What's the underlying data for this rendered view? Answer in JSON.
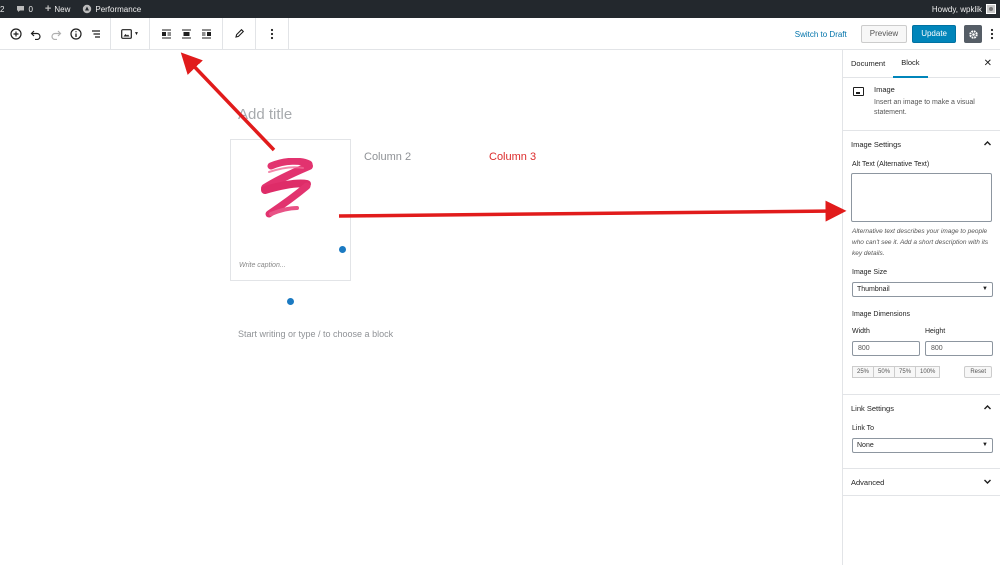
{
  "adminbar": {
    "site_fragment": "2",
    "comments_count": "0",
    "new_label": "New",
    "performance_label": "Performance",
    "howdy": "Howdy, wpklik"
  },
  "toolbar": {
    "switch_to_draft": "Switch to Draft",
    "preview": "Preview",
    "update": "Update"
  },
  "canvas": {
    "title_placeholder": "Add title",
    "caption_placeholder": "Write caption...",
    "column2": "Column 2",
    "column3": "Column 3",
    "block_placeholder": "Start writing or type / to choose a block",
    "colors": {
      "column3": "#dc2b2b",
      "handle": "#1b7ac2",
      "brush": "#e2336f",
      "arrow": "#e11b1b"
    }
  },
  "sidebar": {
    "tabs": [
      {
        "label": "Document"
      },
      {
        "label": "Block"
      }
    ],
    "block": {
      "name": "Image",
      "description": "Insert an image to make a visual statement."
    },
    "image_settings": {
      "title": "Image Settings",
      "alt_label": "Alt Text (Alternative Text)",
      "alt_help": "Alternative text describes your image to people who can't see it. Add a short description with its key details.",
      "size_label": "Image Size",
      "size_value": "Thumbnail",
      "dimensions_label": "Image Dimensions",
      "width_label": "Width",
      "height_label": "Height",
      "width_value": "800",
      "height_value": "800",
      "percent_buttons": [
        "25%",
        "50%",
        "75%",
        "100%"
      ],
      "reset": "Reset"
    },
    "link_settings": {
      "title": "Link Settings",
      "link_to_label": "Link To",
      "link_to_value": "None"
    },
    "advanced": {
      "title": "Advanced"
    }
  }
}
